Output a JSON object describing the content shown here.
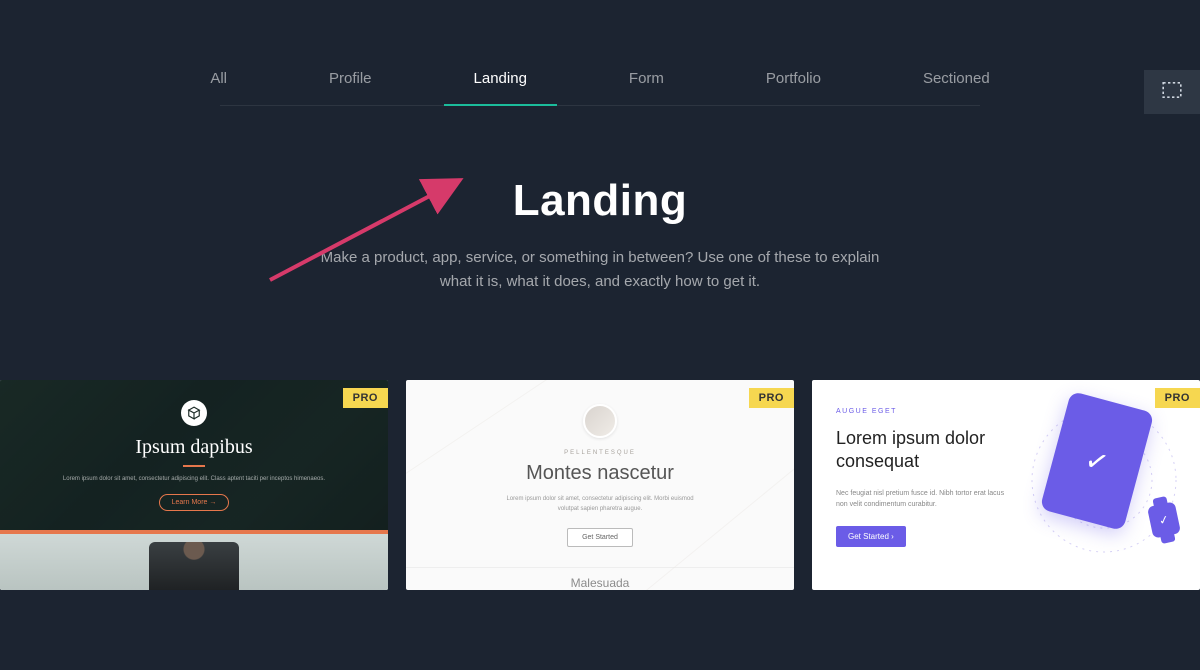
{
  "tabs": [
    {
      "label": "All",
      "active": false
    },
    {
      "label": "Profile",
      "active": false
    },
    {
      "label": "Landing",
      "active": true
    },
    {
      "label": "Form",
      "active": false
    },
    {
      "label": "Portfolio",
      "active": false
    },
    {
      "label": "Sectioned",
      "active": false
    }
  ],
  "hero": {
    "title": "Landing",
    "description": "Make a product, app, service, or something in between? Use one of these to explain what it is, what it does, and exactly how to get it."
  },
  "badge_label": "PRO",
  "templates": [
    {
      "title": "Ipsum dapibus",
      "subtitle": "Lorem ipsum dolor sit amet, consectetur adipiscing elit. Class aptent taciti per inceptos himenaeos.",
      "button": "Learn More →"
    },
    {
      "eyebrow": "PELLENTESQUE",
      "title": "Montes nascetur",
      "subtitle": "Lorem ipsum dolor sit amet, consectetur adipiscing elit. Morbi euismod volutpat sapien pharetra augue.",
      "button": "Get Started",
      "footer": "Malesuada"
    },
    {
      "eyebrow": "AUGUE EGET",
      "title": "Lorem ipsum dolor consequat",
      "subtitle": "Nec feugiat nisl pretium fusce id. Nibh tortor erat lacus non velit condimentum curabitur.",
      "button": "Get Started ›"
    }
  ],
  "colors": {
    "accent_teal": "#1bbc9b",
    "annotation": "#d63a6a",
    "pro_badge": "#f6d750",
    "card1_accent": "#e6774c",
    "card3_accent": "#6b5ce7"
  }
}
